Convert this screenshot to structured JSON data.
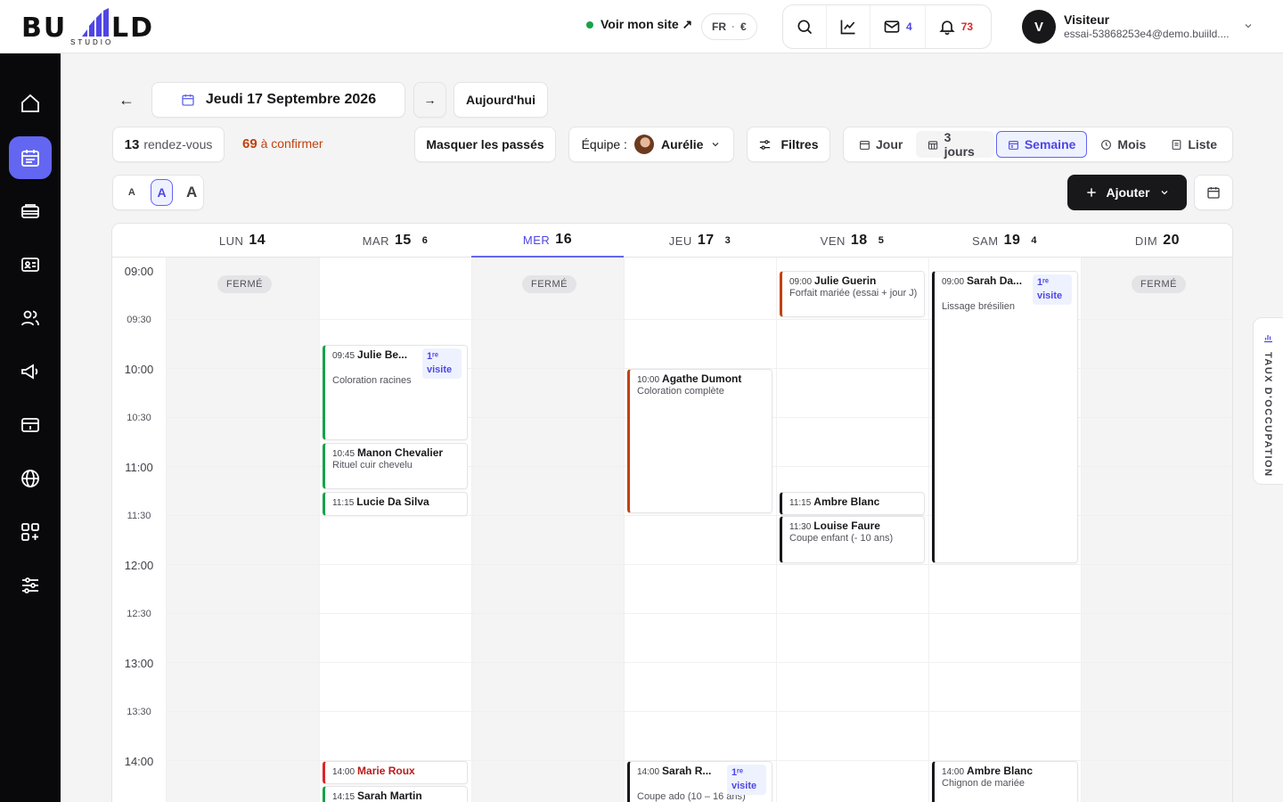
{
  "brand": {
    "name": "BUILD",
    "sub": "STUDIO"
  },
  "topbar": {
    "site_link": "Voir mon site ↗",
    "lang": "FR",
    "currency": "€",
    "mail_count": "4",
    "notif_count": "73",
    "user_initial": "V",
    "user_name": "Visiteur",
    "user_email": "essai-53868253e4@demo.buiild...."
  },
  "colors": {
    "accent": "#6366f1",
    "confirm": "#c2410c",
    "green": "#16a34a",
    "danger": "#dc2626"
  },
  "toolbar": {
    "prev": "←",
    "date_label": "Jeudi 17 Septembre 2026",
    "next": "→",
    "today": "Aujourd'hui",
    "rdv_count": "13",
    "rdv_label": "rendez-vous",
    "confirm_count": "69",
    "confirm_label": "à confirmer",
    "hide_past": "Masquer les passés",
    "team_label": "Équipe :",
    "team_member": "Aurélie",
    "filters": "Filtres",
    "views": {
      "day": "Jour",
      "three": "3 jours",
      "week": "Semaine",
      "month": "Mois",
      "list": "Liste"
    },
    "font_small": "A",
    "font_medium": "A",
    "font_large": "A",
    "add": "Ajouter"
  },
  "calendar": {
    "closed_label": "FERMÉ",
    "days": [
      {
        "dow": "LUN",
        "num": "14",
        "count": ""
      },
      {
        "dow": "MAR",
        "num": "15",
        "count": "6"
      },
      {
        "dow": "MER",
        "num": "16",
        "count": ""
      },
      {
        "dow": "JEU",
        "num": "17",
        "count": "3"
      },
      {
        "dow": "VEN",
        "num": "18",
        "count": "5"
      },
      {
        "dow": "SAM",
        "num": "19",
        "count": "4"
      },
      {
        "dow": "DIM",
        "num": "20",
        "count": ""
      }
    ],
    "times": [
      "09:00",
      "09:30",
      "10:00",
      "10:30",
      "11:00",
      "11:30",
      "12:00",
      "12:30",
      "13:00",
      "13:30",
      "14:00"
    ],
    "first_visit": "1ʳᵉ visite",
    "events": {
      "e1": {
        "time": "09:45",
        "name": "Julie Be...",
        "service": "Coloration racines"
      },
      "e2": {
        "time": "10:45",
        "name": "Manon Chevalier",
        "service": "Rituel cuir chevelu"
      },
      "e3": {
        "time": "11:15",
        "name": "Lucie Da Silva",
        "service": ""
      },
      "e4": {
        "time": "14:00",
        "name": "Marie Roux",
        "service": ""
      },
      "e5": {
        "time": "14:15",
        "name": "Sarah Martin",
        "service": ""
      },
      "e6": {
        "time": "10:00",
        "name": "Agathe Dumont",
        "service": "Coloration complète"
      },
      "e7": {
        "time": "14:00",
        "name": "Sarah R...",
        "service": "Coupe ado (10 – 16 ans)"
      },
      "e8": {
        "time": "09:00",
        "name": "Julie Guerin",
        "service": "Forfait mariée (essai + jour J)"
      },
      "e9": {
        "time": "11:15",
        "name": "Ambre Blanc",
        "service": ""
      },
      "e10": {
        "time": "11:30",
        "name": "Louise Faure",
        "service": "Coupe enfant (- 10 ans)"
      },
      "e11": {
        "time": "09:00",
        "name": "Sarah Da...",
        "service": "Lissage brésilien"
      },
      "e12": {
        "time": "14:00",
        "name": "Ambre Blanc",
        "service": "Chignon de mariée"
      }
    }
  },
  "occupancy_tab": "TAUX D'OCCUPATION"
}
